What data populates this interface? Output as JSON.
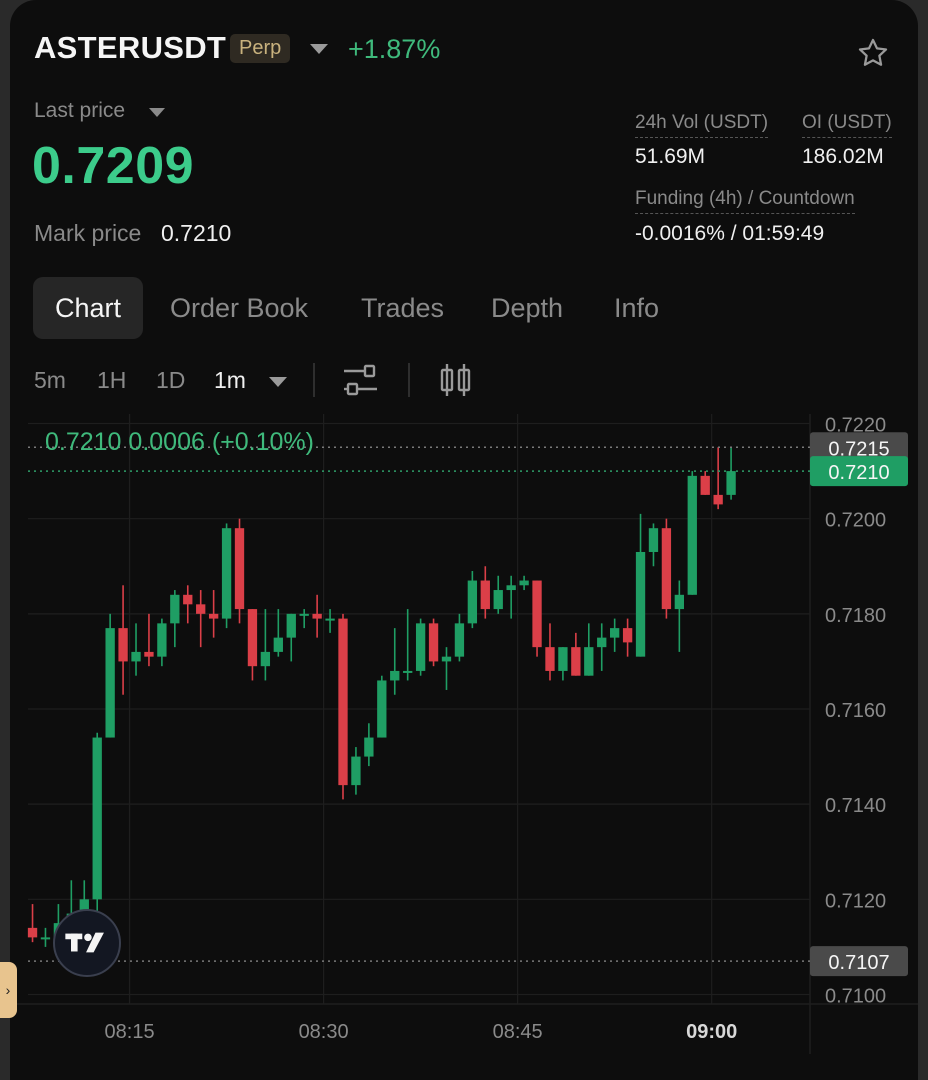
{
  "header": {
    "symbol": "ASTERUSDT",
    "badge": "Perp",
    "change_pct": "+1.87%"
  },
  "price": {
    "last_price_label": "Last price",
    "last_price": "0.7209",
    "mark_price_label": "Mark price",
    "mark_price": "0.7210"
  },
  "stats": {
    "vol_label": "24h Vol (USDT)",
    "vol_value": "51.69M",
    "oi_label": "OI (USDT)",
    "oi_value": "186.02M",
    "funding_label": "Funding (4h) / Countdown",
    "funding_value": "-0.0016% / 01:59:49"
  },
  "tabs": [
    "Chart",
    "Order Book",
    "Trades",
    "Depth",
    "Info"
  ],
  "active_tab": "Chart",
  "timeframes": [
    "5m",
    "1H",
    "1D",
    "1m"
  ],
  "active_timeframe": "1m",
  "ohlc_info": "0.7210  0.0006 (+0.10%)",
  "colors": {
    "up": "#1f9e64",
    "down": "#db3f48",
    "accent_green": "#3ccc8b",
    "background": "#0d0d0d"
  },
  "chart_data": {
    "type": "candlestick",
    "title": "",
    "xlabel": "",
    "ylabel": "",
    "ylim": [
      0.7098,
      0.7222
    ],
    "y_ticks": [
      "0.7100",
      "0.7120",
      "0.7140",
      "0.7160",
      "0.7180",
      "0.7200",
      "0.7220"
    ],
    "x_ticks": [
      "08:15",
      "08:30",
      "08:45",
      "09:00"
    ],
    "x_tick_minutes": [
      15,
      30,
      45,
      60
    ],
    "x_range_minutes": [
      7.15,
      67.6
    ],
    "grid": true,
    "price_lines": [
      {
        "label": "0.7215",
        "value": 0.7215,
        "style": "gray"
      },
      {
        "label": "0.7210",
        "value": 0.721,
        "style": "green"
      },
      {
        "label": "0.7107",
        "value": 0.7107,
        "style": "gray"
      }
    ],
    "candles": [
      {
        "t": 7.5,
        "o": 0.7114,
        "h": 0.7119,
        "l": 0.7111,
        "c": 0.7112
      },
      {
        "t": 8.5,
        "o": 0.7112,
        "h": 0.7114,
        "l": 0.711,
        "c": 0.7112
      },
      {
        "t": 9.5,
        "o": 0.7112,
        "h": 0.7119,
        "l": 0.711,
        "c": 0.7115
      },
      {
        "t": 10.5,
        "o": 0.7115,
        "h": 0.7124,
        "l": 0.7112,
        "c": 0.7117
      },
      {
        "t": 11.5,
        "o": 0.7117,
        "h": 0.7124,
        "l": 0.7115,
        "c": 0.712
      },
      {
        "t": 12.5,
        "o": 0.712,
        "h": 0.7155,
        "l": 0.7114,
        "c": 0.7154
      },
      {
        "t": 13.5,
        "o": 0.7154,
        "h": 0.718,
        "l": 0.7154,
        "c": 0.7177
      },
      {
        "t": 14.5,
        "o": 0.7177,
        "h": 0.7186,
        "l": 0.7163,
        "c": 0.717
      },
      {
        "t": 15.5,
        "o": 0.717,
        "h": 0.7178,
        "l": 0.7167,
        "c": 0.7172
      },
      {
        "t": 16.5,
        "o": 0.7172,
        "h": 0.718,
        "l": 0.7169,
        "c": 0.7171
      },
      {
        "t": 17.5,
        "o": 0.7171,
        "h": 0.7179,
        "l": 0.7169,
        "c": 0.7178
      },
      {
        "t": 18.5,
        "o": 0.7178,
        "h": 0.7185,
        "l": 0.7173,
        "c": 0.7184
      },
      {
        "t": 19.5,
        "o": 0.7184,
        "h": 0.7186,
        "l": 0.7178,
        "c": 0.7182
      },
      {
        "t": 20.5,
        "o": 0.7182,
        "h": 0.7185,
        "l": 0.7173,
        "c": 0.718
      },
      {
        "t": 21.5,
        "o": 0.718,
        "h": 0.7185,
        "l": 0.7175,
        "c": 0.7179
      },
      {
        "t": 22.5,
        "o": 0.7179,
        "h": 0.7199,
        "l": 0.7177,
        "c": 0.7198
      },
      {
        "t": 23.5,
        "o": 0.7198,
        "h": 0.72,
        "l": 0.7178,
        "c": 0.7181
      },
      {
        "t": 24.5,
        "o": 0.7181,
        "h": 0.7181,
        "l": 0.7166,
        "c": 0.7169
      },
      {
        "t": 25.5,
        "o": 0.7169,
        "h": 0.7181,
        "l": 0.7166,
        "c": 0.7172
      },
      {
        "t": 26.5,
        "o": 0.7172,
        "h": 0.7181,
        "l": 0.7171,
        "c": 0.7175
      },
      {
        "t": 27.5,
        "o": 0.7175,
        "h": 0.718,
        "l": 0.717,
        "c": 0.718
      },
      {
        "t": 28.5,
        "o": 0.718,
        "h": 0.7181,
        "l": 0.7177,
        "c": 0.718
      },
      {
        "t": 29.5,
        "o": 0.718,
        "h": 0.7184,
        "l": 0.7175,
        "c": 0.7179
      },
      {
        "t": 30.5,
        "o": 0.7179,
        "h": 0.7181,
        "l": 0.7176,
        "c": 0.7179
      },
      {
        "t": 31.5,
        "o": 0.7179,
        "h": 0.718,
        "l": 0.7141,
        "c": 0.7144
      },
      {
        "t": 32.5,
        "o": 0.7144,
        "h": 0.7152,
        "l": 0.7142,
        "c": 0.715
      },
      {
        "t": 33.5,
        "o": 0.715,
        "h": 0.7157,
        "l": 0.7148,
        "c": 0.7154
      },
      {
        "t": 34.5,
        "o": 0.7154,
        "h": 0.7167,
        "l": 0.7154,
        "c": 0.7166
      },
      {
        "t": 35.5,
        "o": 0.7166,
        "h": 0.7177,
        "l": 0.7163,
        "c": 0.7168
      },
      {
        "t": 36.5,
        "o": 0.7168,
        "h": 0.7181,
        "l": 0.7166,
        "c": 0.7168
      },
      {
        "t": 37.5,
        "o": 0.7168,
        "h": 0.7179,
        "l": 0.7167,
        "c": 0.7178
      },
      {
        "t": 38.5,
        "o": 0.7178,
        "h": 0.7179,
        "l": 0.7169,
        "c": 0.717
      },
      {
        "t": 39.5,
        "o": 0.717,
        "h": 0.7173,
        "l": 0.7164,
        "c": 0.7171
      },
      {
        "t": 40.5,
        "o": 0.7171,
        "h": 0.718,
        "l": 0.717,
        "c": 0.7178
      },
      {
        "t": 41.5,
        "o": 0.7178,
        "h": 0.7189,
        "l": 0.7177,
        "c": 0.7187
      },
      {
        "t": 42.5,
        "o": 0.7187,
        "h": 0.719,
        "l": 0.7179,
        "c": 0.7181
      },
      {
        "t": 43.5,
        "o": 0.7181,
        "h": 0.7188,
        "l": 0.718,
        "c": 0.7185
      },
      {
        "t": 44.5,
        "o": 0.7185,
        "h": 0.7188,
        "l": 0.7179,
        "c": 0.7186
      },
      {
        "t": 45.5,
        "o": 0.7186,
        "h": 0.7188,
        "l": 0.7185,
        "c": 0.7187
      },
      {
        "t": 46.5,
        "o": 0.7187,
        "h": 0.7187,
        "l": 0.7171,
        "c": 0.7173
      },
      {
        "t": 47.5,
        "o": 0.7173,
        "h": 0.7178,
        "l": 0.7166,
        "c": 0.7168
      },
      {
        "t": 48.5,
        "o": 0.7168,
        "h": 0.7173,
        "l": 0.7166,
        "c": 0.7173
      },
      {
        "t": 49.5,
        "o": 0.7173,
        "h": 0.7176,
        "l": 0.7167,
        "c": 0.7167
      },
      {
        "t": 50.5,
        "o": 0.7167,
        "h": 0.7178,
        "l": 0.7167,
        "c": 0.7173
      },
      {
        "t": 51.5,
        "o": 0.7173,
        "h": 0.7178,
        "l": 0.7168,
        "c": 0.7175
      },
      {
        "t": 52.5,
        "o": 0.7175,
        "h": 0.7179,
        "l": 0.7172,
        "c": 0.7177
      },
      {
        "t": 53.5,
        "o": 0.7177,
        "h": 0.7179,
        "l": 0.7171,
        "c": 0.7174
      },
      {
        "t": 54.5,
        "o": 0.7171,
        "h": 0.7201,
        "l": 0.7171,
        "c": 0.7193
      },
      {
        "t": 55.5,
        "o": 0.7193,
        "h": 0.7199,
        "l": 0.719,
        "c": 0.7198
      },
      {
        "t": 56.5,
        "o": 0.7198,
        "h": 0.72,
        "l": 0.7179,
        "c": 0.7181
      },
      {
        "t": 57.5,
        "o": 0.7181,
        "h": 0.7187,
        "l": 0.7172,
        "c": 0.7184
      },
      {
        "t": 58.5,
        "o": 0.7184,
        "h": 0.721,
        "l": 0.7184,
        "c": 0.7209
      },
      {
        "t": 59.5,
        "o": 0.7209,
        "h": 0.721,
        "l": 0.7205,
        "c": 0.7205
      },
      {
        "t": 60.5,
        "o": 0.7205,
        "h": 0.7215,
        "l": 0.7202,
        "c": 0.7203
      },
      {
        "t": 61.5,
        "o": 0.7205,
        "h": 0.7215,
        "l": 0.7204,
        "c": 0.721
      }
    ]
  }
}
